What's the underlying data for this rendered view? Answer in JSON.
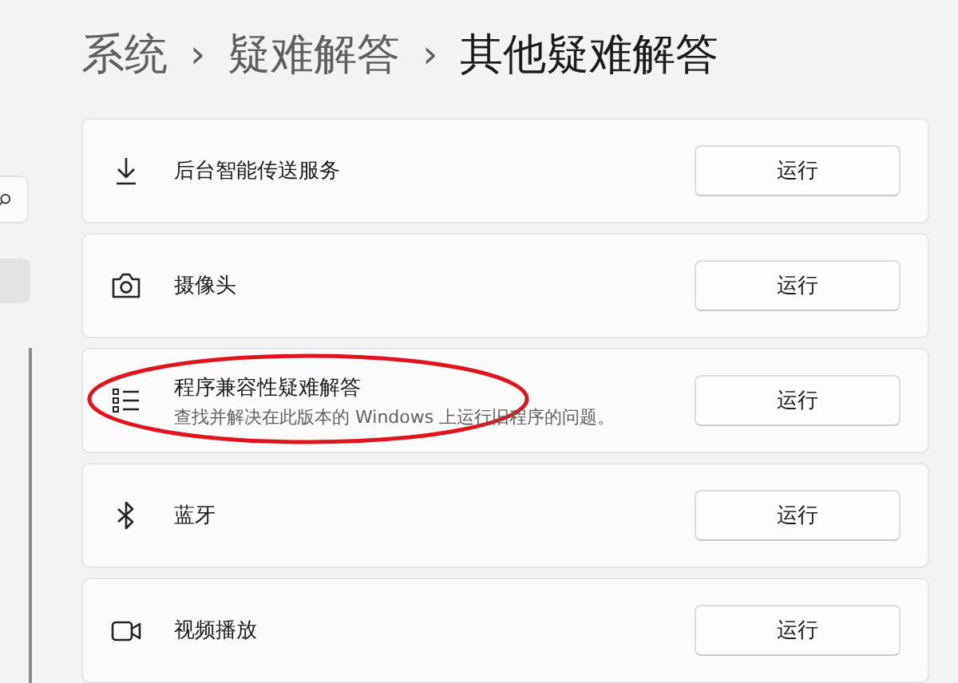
{
  "sidebar": {
    "items": [
      {
        "selected": true
      }
    ]
  },
  "breadcrumb": [
    "系统",
    "疑难解答",
    "其他疑难解答"
  ],
  "separator": "›",
  "items": [
    {
      "title": "后台智能传送服务",
      "button": "运行",
      "highlighted": false
    },
    {
      "title": "摄像头",
      "button": "运行",
      "highlighted": false
    },
    {
      "title": "程序兼容性疑难解答",
      "description": "查找并解决在此版本的 Windows 上运行旧程序的问题。",
      "button": "运行",
      "highlighted": true
    },
    {
      "title": "蓝牙",
      "button": "运行",
      "highlighted": false
    },
    {
      "title": "视频播放",
      "button": "运行",
      "highlighted": false
    }
  ]
}
